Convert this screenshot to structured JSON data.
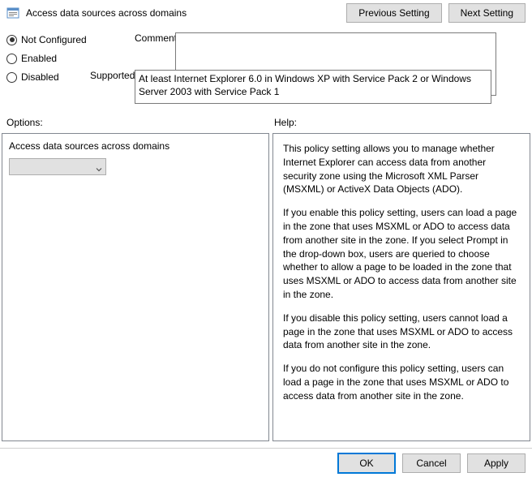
{
  "header": {
    "title": "Access data sources across domains",
    "prev_btn": "Previous Setting",
    "next_btn": "Next Setting"
  },
  "config": {
    "not_configured": "Not Configured",
    "enabled": "Enabled",
    "disabled": "Disabled",
    "comment_label": "Comment:",
    "comment_value": "",
    "supported_label": "Supported on:",
    "supported_text": "At least Internet Explorer 6.0 in Windows XP with Service Pack 2 or Windows Server 2003 with Service Pack 1"
  },
  "labels": {
    "options": "Options:",
    "help": "Help:"
  },
  "options": {
    "setting_name": "Access data sources across domains",
    "dropdown_value": ""
  },
  "help": {
    "p1": "This policy setting allows you to manage whether Internet Explorer can access data from another security zone using the Microsoft XML Parser (MSXML) or ActiveX Data Objects (ADO).",
    "p2": "If you enable this policy setting, users can load a page in the zone that uses MSXML or ADO to access data from another site in the zone. If you select Prompt in the drop-down box, users are queried to choose whether to allow a page to be loaded in the zone that uses MSXML or ADO to access data from another site in the zone.",
    "p3": "If you disable this policy setting, users cannot load a page in the zone that uses MSXML or ADO to access data from another site in the zone.",
    "p4": "If you do not configure this policy setting, users can load a page in the zone that uses MSXML or ADO to access data from another site in the zone."
  },
  "footer": {
    "ok": "OK",
    "cancel": "Cancel",
    "apply": "Apply"
  }
}
